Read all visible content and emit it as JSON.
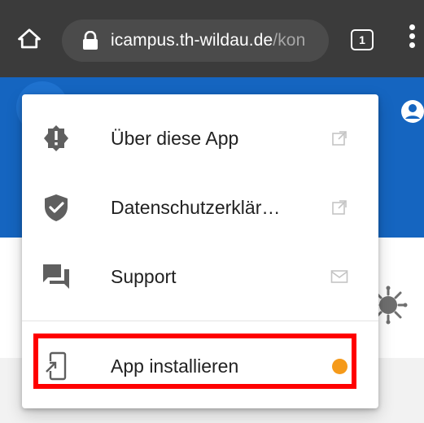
{
  "browser": {
    "url_host": "icampus.th-wildau.de",
    "url_path": "/kon",
    "tab_count": "1"
  },
  "menu": {
    "items": [
      {
        "label": "Über diese App",
        "icon": "alert-badge-icon",
        "trailing": "external-link-icon"
      },
      {
        "label": "Datenschutzerklär…",
        "icon": "shield-check-icon",
        "trailing": "external-link-icon"
      },
      {
        "label": "Support",
        "icon": "chat-bubble-icon",
        "trailing": "mail-icon"
      },
      {
        "label": "App installieren",
        "icon": "install-app-icon",
        "trailing": "notification-dot"
      }
    ]
  },
  "colors": {
    "chrome_bg": "#3b3b3b",
    "page_header": "#1565c0",
    "highlight": "#ff0000",
    "notification_dot": "#f59a1a"
  }
}
